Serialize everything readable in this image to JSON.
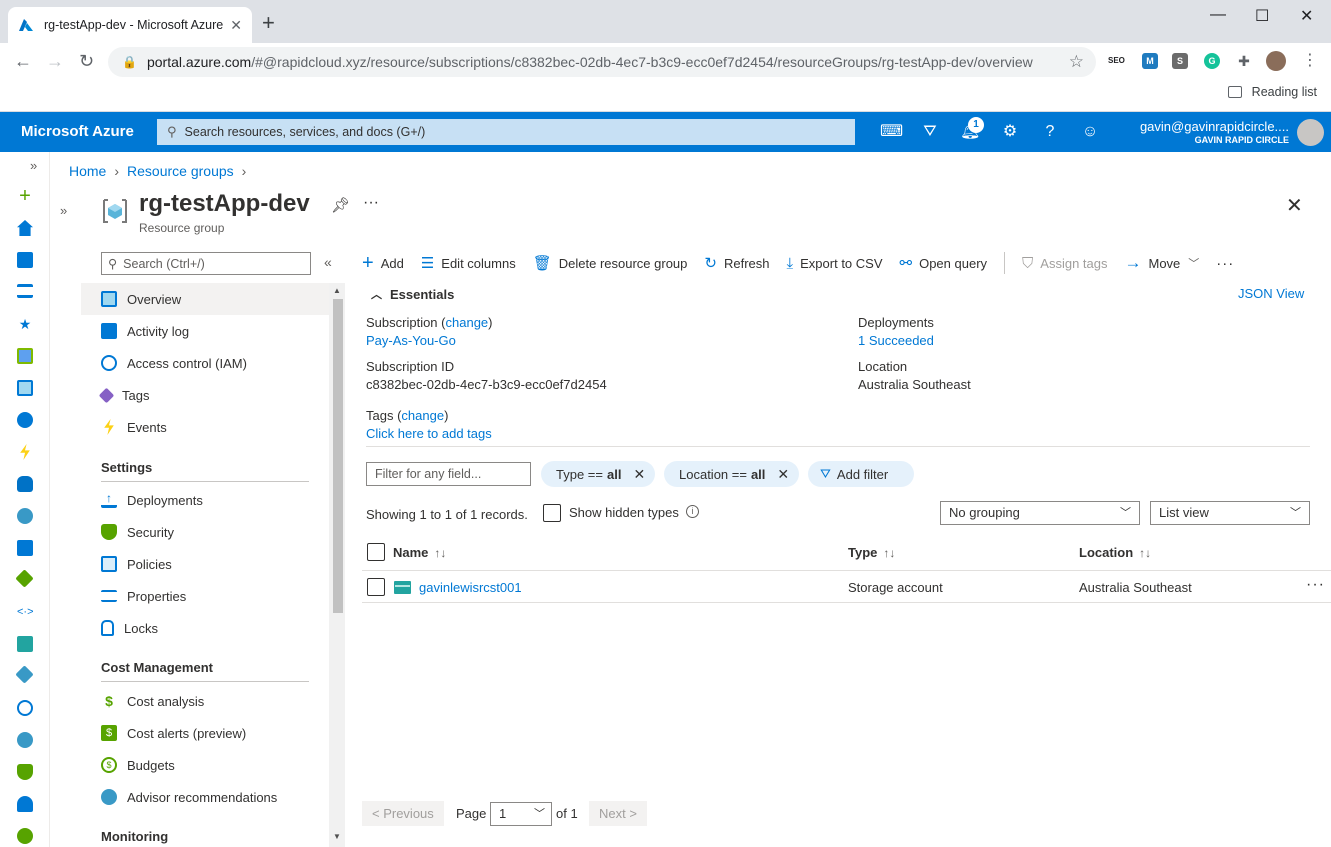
{
  "browser": {
    "tab_title": "rg-testApp-dev - Microsoft Azure",
    "url_host": "portal.azure.com",
    "url_path": "/#@rapidcloud.xyz/resource/subscriptions/c8382bec-02db-4ec7-b3c9-ecc0ef7d2454/resourceGroups/rg-testApp-dev/overview",
    "reading_list": "Reading list"
  },
  "azure": {
    "brand": "Microsoft Azure",
    "search_placeholder": "Search resources, services, and docs (G+/)",
    "notification_count": "1",
    "account_user": "gavin@gavinrapidcircle....",
    "account_org": "GAVIN RAPID CIRCLE"
  },
  "breadcrumb": [
    "Home",
    "Resource groups"
  ],
  "resource": {
    "title": "rg-testApp-dev",
    "subtitle": "Resource group"
  },
  "menu": {
    "search_placeholder": "Search (Ctrl+/)",
    "items_top": [
      "Overview",
      "Activity log",
      "Access control (IAM)",
      "Tags",
      "Events"
    ],
    "settings_header": "Settings",
    "settings_items": [
      "Deployments",
      "Security",
      "Policies",
      "Properties",
      "Locks"
    ],
    "cost_header": "Cost Management",
    "cost_items": [
      "Cost analysis",
      "Cost alerts (preview)",
      "Budgets",
      "Advisor recommendations"
    ],
    "monitoring_header": "Monitoring"
  },
  "commands": {
    "add": "Add",
    "edit_columns": "Edit columns",
    "delete": "Delete resource group",
    "refresh": "Refresh",
    "export": "Export to CSV",
    "open_query": "Open query",
    "assign_tags": "Assign tags",
    "move": "Move"
  },
  "essentials": {
    "title": "Essentials",
    "json_view": "JSON View",
    "subscription_label": "Subscription",
    "change": "change",
    "subscription_value": "Pay-As-You-Go",
    "subscription_id_label": "Subscription ID",
    "subscription_id_value": "c8382bec-02db-4ec7-b3c9-ecc0ef7d2454",
    "tags_label": "Tags",
    "tags_value": "Click here to add tags",
    "deployments_label": "Deployments",
    "deployments_value": "1 Succeeded",
    "location_label": "Location",
    "location_value": "Australia Southeast"
  },
  "filters": {
    "placeholder": "Filter for any field...",
    "type_label": "Type ==",
    "type_value": "all",
    "location_label": "Location ==",
    "location_value": "all",
    "add_filter": "Add filter"
  },
  "listing": {
    "showing": "Showing 1 to 1 of 1 records.",
    "show_hidden": "Show hidden types",
    "grouping": "No grouping",
    "view": "List view"
  },
  "grid": {
    "columns": [
      "Name",
      "Type",
      "Location"
    ],
    "rows": [
      {
        "name": "gavinlewisrcst001",
        "type": "Storage account",
        "location": "Australia Southeast"
      }
    ]
  },
  "pagination": {
    "previous": "< Previous",
    "page_label": "Page",
    "page_value": "1",
    "of_label": "of 1",
    "next": "Next >"
  },
  "colors": {
    "azure_blue": "#0078d4",
    "search_bg": "#c7e0f4",
    "pill_bg": "#e5f1fb"
  }
}
